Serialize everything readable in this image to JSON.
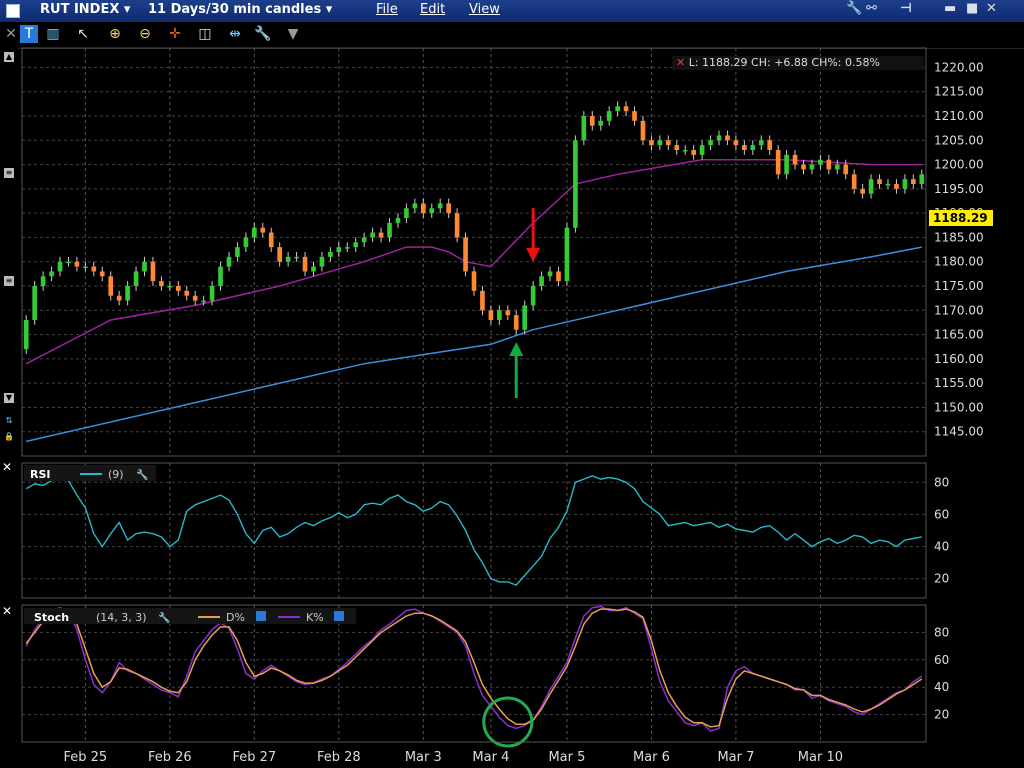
{
  "window": {
    "symbol": "RUT INDEX",
    "period": "11 Days/30 min candles",
    "menus": [
      "File",
      "Edit",
      "View"
    ],
    "status": "L: 1188.29 CH: +6.88 CH%: 0.58%"
  },
  "toolbar": {
    "icons": [
      "t-icon",
      "bars-icon",
      "cursor-icon",
      "zoom-in-icon",
      "zoom-out-icon",
      "crosshair-icon",
      "split-icon",
      "split2-icon",
      "wrench-icon",
      "dropdown-icon"
    ]
  },
  "colors": {
    "up": "#33cc33",
    "down": "#ff8833",
    "ma_short": "#a020a0",
    "ma_long": "#3a8ee0",
    "rsi": "#28b8c8",
    "stoch_d": "#e8a050",
    "stoch_k": "#8a30d0",
    "last_price_bg": "#ffee00"
  },
  "chart_data": [
    {
      "type": "candlestick",
      "title": "RUT INDEX",
      "ylim": [
        1140,
        1224
      ],
      "price_labels": [
        "1220.00",
        "1215.00",
        "1210.00",
        "1205.00",
        "1200.00",
        "1195.00",
        "1190.00",
        "1185.00",
        "1180.00",
        "1175.00",
        "1170.00",
        "1165.00",
        "1160.00",
        "1155.00",
        "1150.00",
        "1145.00"
      ],
      "last_price": "1188.29",
      "x_labels": [
        "Feb 25",
        "Feb 26",
        "Feb 27",
        "Feb 28",
        "Mar 3",
        "Mar 4",
        "Mar 5",
        "Mar 6",
        "Mar 7",
        "Mar 10"
      ],
      "closes": [
        1168,
        1175,
        1177,
        1178,
        1180,
        1180,
        1179,
        1179,
        1178,
        1177,
        1173,
        1172,
        1175,
        1178,
        1180,
        1176,
        1175,
        1175,
        1174,
        1173,
        1172,
        1172,
        1175,
        1179,
        1181,
        1183,
        1185,
        1187,
        1186,
        1183,
        1180,
        1181,
        1181,
        1178,
        1179,
        1181,
        1182,
        1183,
        1183,
        1184,
        1185,
        1186,
        1185,
        1188,
        1189,
        1191,
        1192,
        1190,
        1191,
        1192,
        1190,
        1185,
        1178,
        1174,
        1170,
        1168,
        1170,
        1169,
        1166,
        1171,
        1175,
        1177,
        1178,
        1176,
        1187,
        1205,
        1210,
        1208,
        1209,
        1211,
        1212,
        1211,
        1209,
        1205,
        1204,
        1205,
        1204,
        1203,
        1203,
        1202,
        1204,
        1205,
        1206,
        1205,
        1204,
        1203,
        1204,
        1205,
        1203,
        1198,
        1202,
        1200,
        1199,
        1200,
        1201,
        1199,
        1200,
        1198,
        1195,
        1194,
        1197,
        1196,
        1196,
        1195,
        1197,
        1196,
        1198
      ],
      "ma_short": {
        "x": [
          0,
          10,
          20,
          30,
          40,
          45,
          48,
          50,
          52,
          55,
          60,
          65,
          70,
          80,
          90,
          100,
          106
        ],
        "y": [
          1159,
          1168,
          1171,
          1175,
          1180,
          1183,
          1183,
          1182,
          1180,
          1179,
          1188,
          1196,
          1198,
          1201,
          1201,
          1200,
          1200
        ]
      },
      "ma_long": {
        "x": [
          0,
          20,
          40,
          55,
          60,
          70,
          80,
          90,
          100,
          106
        ],
        "y": [
          1143,
          1151,
          1159,
          1163,
          1166,
          1170,
          1174,
          1178,
          1181,
          1183
        ]
      }
    },
    {
      "type": "line",
      "title": "RSI",
      "label": "(9)",
      "ylim": [
        8,
        92
      ],
      "ticks": [
        "80",
        "60",
        "40",
        "20"
      ],
      "values": [
        76,
        79,
        78,
        81,
        82,
        81,
        72,
        64,
        48,
        40,
        48,
        55,
        44,
        48,
        49,
        48,
        46,
        40,
        44,
        62,
        66,
        68,
        70,
        72,
        69,
        60,
        48,
        42,
        50,
        52,
        46,
        48,
        52,
        55,
        53,
        56,
        58,
        61,
        58,
        60,
        66,
        67,
        66,
        70,
        72,
        68,
        66,
        62,
        64,
        68,
        66,
        59,
        50,
        38,
        30,
        20,
        18,
        18,
        16,
        22,
        28,
        34,
        45,
        52,
        62,
        80,
        82,
        84,
        82,
        83,
        82,
        80,
        76,
        68,
        64,
        60,
        53,
        54,
        55,
        53,
        54,
        55,
        52,
        54,
        51,
        50,
        49,
        52,
        53,
        49,
        44,
        48,
        44,
        40,
        43,
        45,
        42,
        44,
        47,
        46,
        42,
        44,
        43,
        40,
        44,
        45,
        46
      ]
    },
    {
      "type": "line",
      "title": "Stoch",
      "label": "(14, 3, 3)",
      "legend": [
        "D%",
        "K%"
      ],
      "ylim": [
        0,
        100
      ],
      "ticks": [
        "80",
        "60",
        "40",
        "20"
      ],
      "k": [
        70,
        82,
        90,
        96,
        98,
        95,
        82,
        60,
        42,
        36,
        44,
        58,
        52,
        50,
        46,
        42,
        38,
        36,
        33,
        48,
        66,
        74,
        82,
        87,
        83,
        68,
        50,
        46,
        52,
        56,
        52,
        48,
        44,
        42,
        43,
        46,
        48,
        53,
        58,
        64,
        70,
        75,
        82,
        86,
        91,
        96,
        97,
        94,
        92,
        88,
        84,
        80,
        70,
        50,
        34,
        26,
        18,
        12,
        10,
        12,
        16,
        26,
        38,
        48,
        58,
        76,
        92,
        98,
        99,
        96,
        96,
        98,
        94,
        90,
        68,
        44,
        30,
        22,
        14,
        12,
        14,
        8,
        10,
        40,
        52,
        55,
        50,
        48,
        46,
        44,
        42,
        38,
        38,
        32,
        34,
        30,
        28,
        26,
        22,
        20,
        24,
        28,
        32,
        36,
        38,
        44,
        48
      ],
      "d": [
        72,
        80,
        88,
        94,
        96,
        95,
        86,
        68,
        50,
        40,
        44,
        54,
        53,
        50,
        47,
        44,
        40,
        37,
        36,
        44,
        60,
        70,
        78,
        84,
        84,
        74,
        58,
        48,
        50,
        54,
        52,
        49,
        45,
        43,
        43,
        45,
        48,
        52,
        56,
        62,
        68,
        74,
        80,
        84,
        88,
        92,
        94,
        94,
        92,
        89,
        85,
        81,
        73,
        58,
        42,
        32,
        24,
        17,
        13,
        13,
        16,
        24,
        35,
        45,
        55,
        70,
        86,
        94,
        97,
        97,
        96,
        97,
        95,
        91,
        74,
        52,
        36,
        26,
        18,
        14,
        14,
        11,
        12,
        32,
        46,
        52,
        50,
        48,
        46,
        44,
        42,
        39,
        38,
        34,
        34,
        31,
        29,
        27,
        24,
        22,
        24,
        27,
        31,
        35,
        38,
        42,
        46
      ]
    }
  ]
}
